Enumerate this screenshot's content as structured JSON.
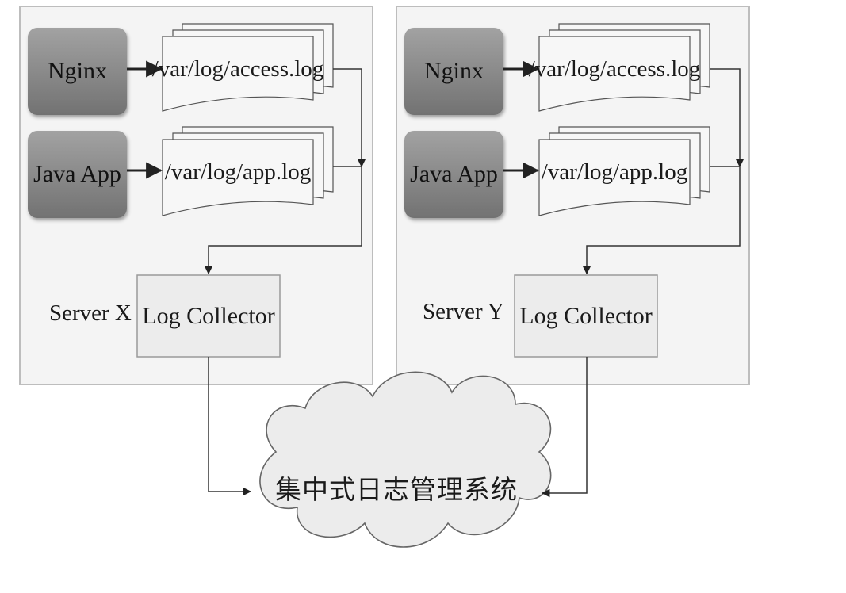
{
  "servers": [
    {
      "label": "Server X",
      "apps": [
        {
          "name": "Nginx",
          "log": "/var/log/access.log"
        },
        {
          "name": "Java App",
          "log": "/var/log/app.log"
        }
      ],
      "collector": "Log Collector"
    },
    {
      "label": "Server Y",
      "apps": [
        {
          "name": "Nginx",
          "log": "/var/log/access.log"
        },
        {
          "name": "Java App",
          "log": "/var/log/app.log"
        }
      ],
      "collector": "Log Collector"
    }
  ],
  "central_system": "集中式日志管理系统",
  "colors": {
    "server_bg": "#f4f4f4",
    "server_border": "#bdbdbd",
    "app_box": "#8a8a8a",
    "collector_bg": "#ececec",
    "line": "#333333"
  }
}
